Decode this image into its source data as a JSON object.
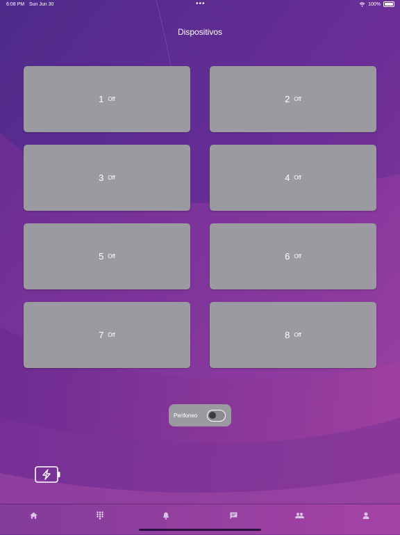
{
  "status_bar": {
    "time": "6:08 PM",
    "date": "Sun Jun 30",
    "dots": "•••",
    "battery_percent": "100%"
  },
  "page_title": "Dispositivos",
  "devices": [
    {
      "number": "1",
      "state": "Off"
    },
    {
      "number": "2",
      "state": "Off"
    },
    {
      "number": "3",
      "state": "Off"
    },
    {
      "number": "4",
      "state": "Off"
    },
    {
      "number": "5",
      "state": "Off"
    },
    {
      "number": "6",
      "state": "Off"
    },
    {
      "number": "7",
      "state": "Off"
    },
    {
      "number": "8",
      "state": "Off"
    }
  ],
  "perifoneo": {
    "label": "Perifoneo",
    "enabled": false
  },
  "energy_button": {
    "icon": "battery-bolt-icon"
  },
  "tab_bar": {
    "tabs": [
      {
        "icon": "home-icon"
      },
      {
        "icon": "keypad-icon"
      },
      {
        "icon": "bell-icon"
      },
      {
        "icon": "chat-icon"
      },
      {
        "icon": "group-icon"
      },
      {
        "icon": "person-icon"
      }
    ]
  },
  "colors": {
    "tile": "#9c9aa1",
    "text": "#ffffff",
    "background_top": "#5a2a8c",
    "background_accent": "#b04aa8"
  }
}
